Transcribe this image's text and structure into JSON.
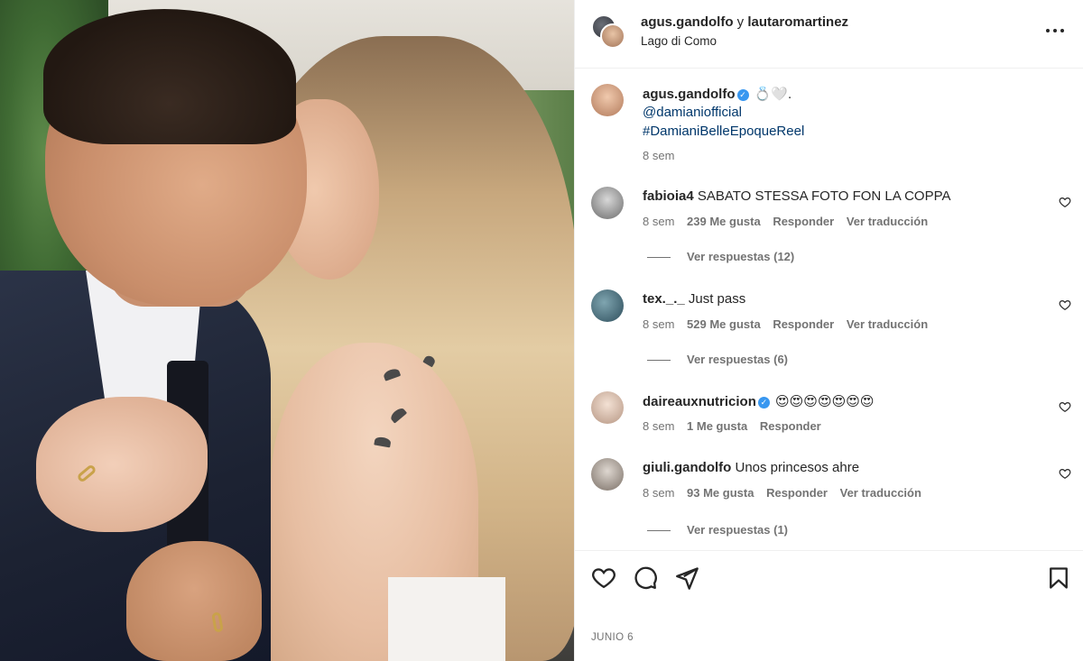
{
  "post": {
    "header": {
      "user1": "agus.gandolfo",
      "connector": "y",
      "user2": "lautaromartinez",
      "location": "Lago di Como"
    },
    "caption": {
      "username": "agus.gandolfo",
      "text": "💍🤍.",
      "mention": "@damianiofficial",
      "hashtag": "#DamianiBelleEpoqueReel",
      "time": "8 sem"
    },
    "comments": [
      {
        "username": "fabioia4",
        "text": "SABATO STESSA FOTO FON LA COPPA",
        "time": "8 sem",
        "likes": "239 Me gusta",
        "reply_label": "Responder",
        "translate_label": "Ver traducción",
        "replies": "Ver respuestas (12)"
      },
      {
        "username": "tex._._",
        "text": "Just pass",
        "time": "8 sem",
        "likes": "529 Me gusta",
        "reply_label": "Responder",
        "translate_label": "Ver traducción",
        "replies": "Ver respuestas (6)"
      },
      {
        "username": "daireauxnutricion",
        "text": "😍😍😍😍😍😍😍",
        "time": "8 sem",
        "likes": "1 Me gusta",
        "reply_label": "Responder"
      },
      {
        "username": "giuli.gandolfo",
        "text": "Unos princesos ahre",
        "time": "8 sem",
        "likes": "93 Me gusta",
        "reply_label": "Responder",
        "translate_label": "Ver traducción",
        "replies": "Ver respuestas (1)"
      }
    ],
    "date": "JUNIO 6"
  },
  "icons": {
    "more": "more-horizontal-icon",
    "like": "heart-icon",
    "comment": "comment-bubble-icon",
    "share": "paper-plane-icon",
    "save": "bookmark-icon",
    "verified": "verified-badge-icon"
  },
  "colors": {
    "text": "#262626",
    "secondary": "#737373",
    "link": "#00376b",
    "verified": "#3897f0",
    "divider": "#efefef"
  }
}
